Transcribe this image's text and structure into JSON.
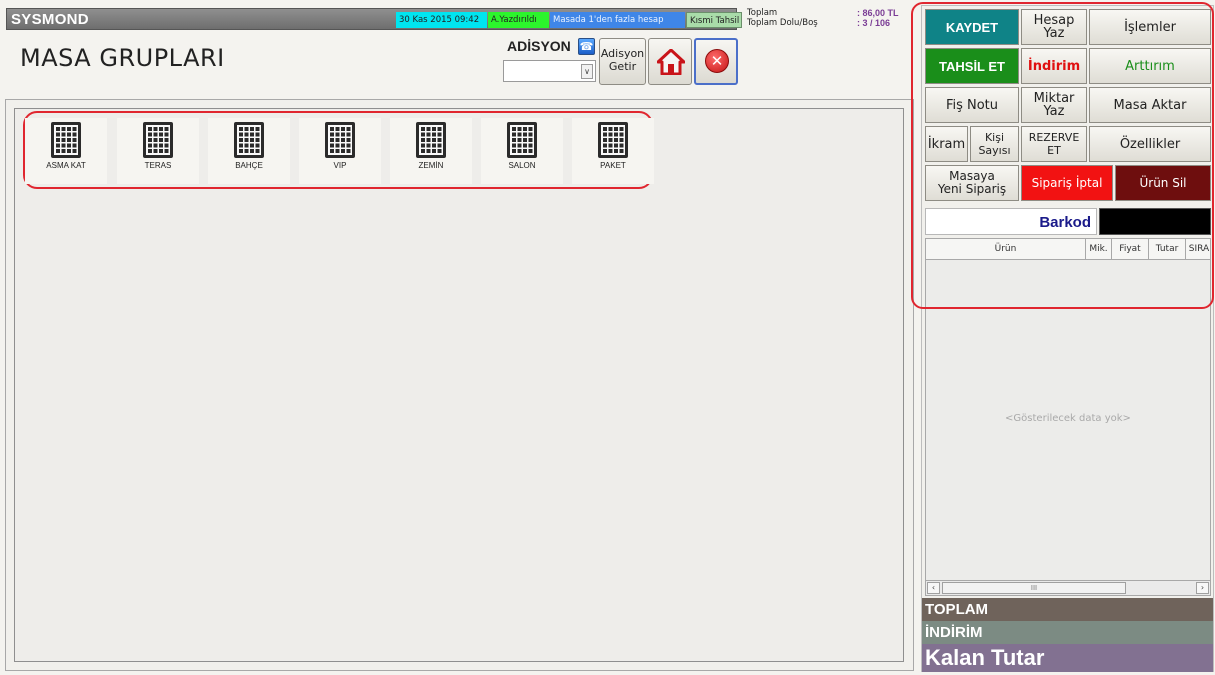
{
  "header": {
    "brand": "SYSMOND",
    "date_time": "30 Kas 2015 09:42",
    "print_status": "A.Yazdırıldı",
    "info_message": "Masada 1'den fazla hesap",
    "partial_payment": "Kısmi Tahsil",
    "summary": {
      "total_label": "Toplam",
      "occupancy_label": "Toplam Dolu/Boş",
      "total_value": ": 86,00 TL",
      "occupancy_value": ": 3 / 106"
    }
  },
  "page": {
    "title": "MASA GRUPLARI"
  },
  "adisyon": {
    "label": "ADİSYON",
    "select_value": "",
    "fetch_label_line1": "Adisyon",
    "fetch_label_line2": "Getir"
  },
  "table_groups": [
    {
      "label": "ASMA KAT"
    },
    {
      "label": "TERAS"
    },
    {
      "label": "BAHÇE"
    },
    {
      "label": "VIP"
    },
    {
      "label": "ZEMİN"
    },
    {
      "label": "SALON"
    },
    {
      "label": "PAKET"
    }
  ],
  "actions": {
    "kaydet": "KAYDET",
    "hesap_yaz": "Hesap Yaz",
    "islemler": "İşlemler",
    "tahsil_et": "TAHSİL ET",
    "indirim": "İndirim",
    "arttirim": "Arttırım",
    "fis_notu": "Fiş Notu",
    "miktar_yaz": "Miktar Yaz",
    "masa_aktar": "Masa Aktar",
    "ikram": "İkram",
    "kisi_sayisi_1": "Kişi",
    "kisi_sayisi_2": "Sayısı",
    "rezerve_1": "REZERVE",
    "rezerve_2": "ET",
    "ozellikler": "Özellikler",
    "masaya_1": "Masaya",
    "masaya_2": "Yeni Sipariş",
    "siparis_iptal": "Sipariş İptal",
    "urun_sil": "Ürün Sil"
  },
  "barkod": {
    "label": "Barkod",
    "value": ""
  },
  "order_grid": {
    "columns": [
      "Ürün",
      "Mik.",
      "Fiyat",
      "Tutar",
      "SIRA"
    ],
    "empty_message": "<Gösterilecek data yok>",
    "scroll_thumb": "III"
  },
  "totals": {
    "toplam": "TOPLAM",
    "indirim": "İNDİRİM",
    "kalan": "Kalan Tutar"
  },
  "colors": {
    "kaydet": "#0f8387",
    "tahsil": "#1a8e1a",
    "iptal": "#f21212",
    "sil": "#6e0e0e",
    "highlight": "#e0262f"
  }
}
